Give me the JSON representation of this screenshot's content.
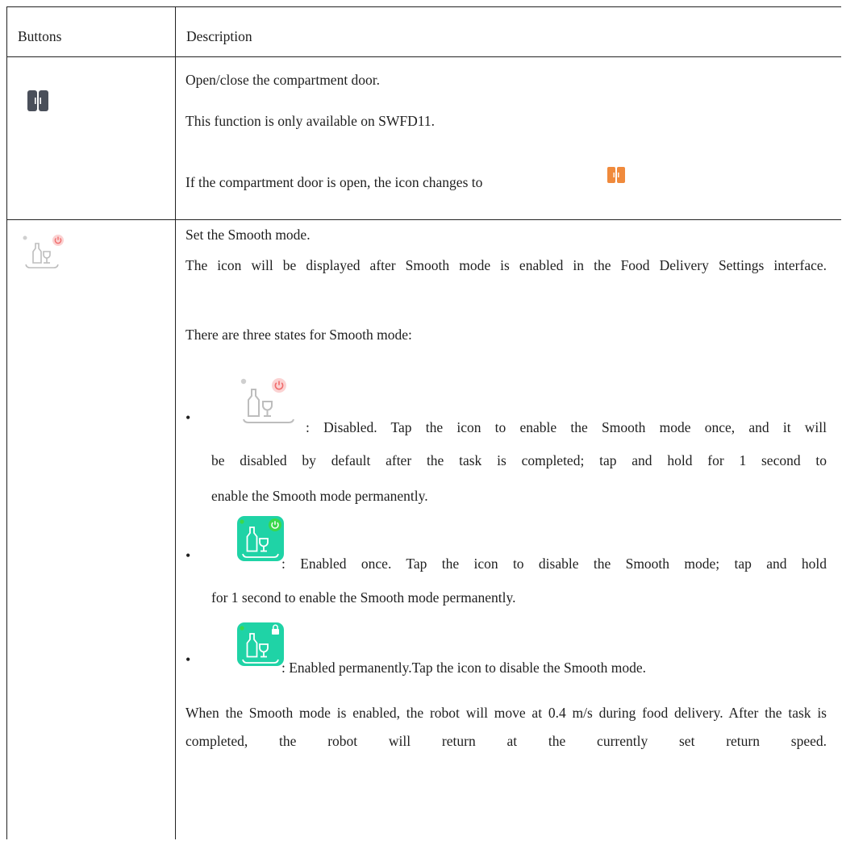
{
  "table": {
    "headers": [
      "Buttons",
      "Description"
    ]
  },
  "rows": [
    {
      "button_icon": "compartment-door-icon",
      "paragraphs": [
        "Open/close the compartment door.",
        "This function is only available on SWFD11.",
        "If the compartment door is open, the icon changes to"
      ],
      "inline_icon": "compartment-door-open-icon"
    },
    {
      "button_icon": "smooth-mode-icon",
      "intro": [
        "Set the Smooth mode.",
        "The icon will be displayed after Smooth mode is enabled in the Food Delivery Settings interface.",
        "There are three states for Smooth mode:"
      ],
      "states": [
        {
          "icon": "smooth-mode-disabled-icon",
          "line1": ": Disabled. Tap the icon to enable the Smooth mode once, and it will",
          "line2": "be disabled by default after the task is completed; tap and hold for 1 second to",
          "line3": "enable the Smooth mode permanently."
        },
        {
          "icon": "smooth-mode-enabled-once-icon",
          "line1": ": Enabled once. Tap the icon to disable the Smooth mode; tap and hold",
          "line2": "for 1 second to enable the Smooth mode permanently."
        },
        {
          "icon": "smooth-mode-enabled-permanently-icon",
          "line1": ": Enabled permanently.Tap the icon to disable the Smooth mode."
        }
      ],
      "outro": "When the Smooth mode is enabled, the robot will move at 0.4 m/s during food delivery. After the task is completed, the robot will return at the currently set return speed."
    }
  ],
  "colors": {
    "door_closed": "#4a4f5a",
    "door_open": "#f08a3c",
    "smooth_enabled_bg": "#1fd3a6",
    "power_red": "#f06b6b",
    "power_green": "#3ad84a"
  }
}
